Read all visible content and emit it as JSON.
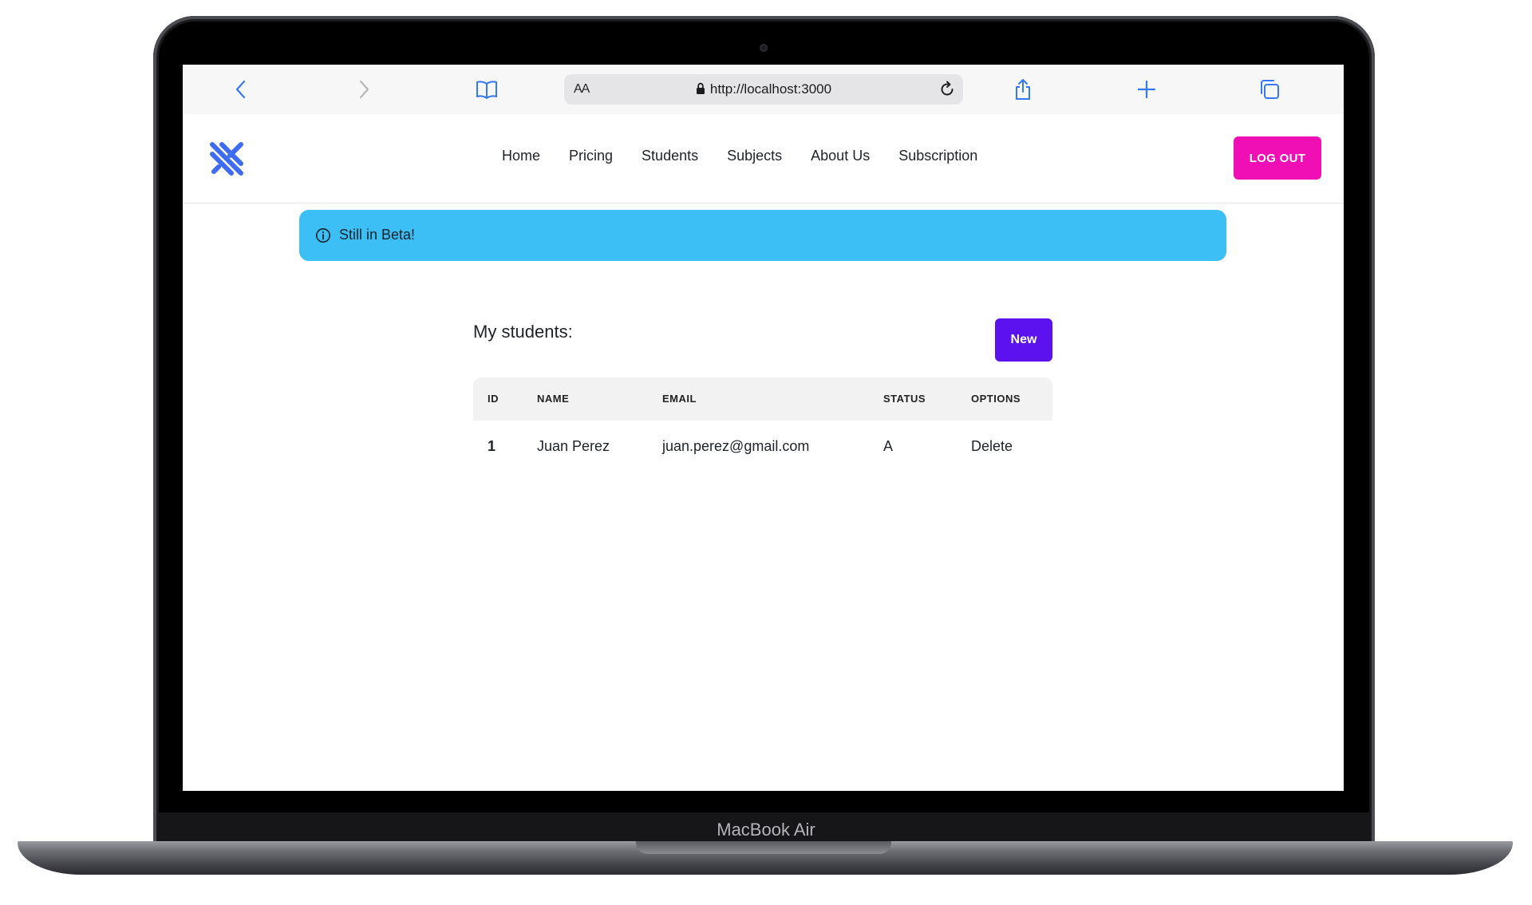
{
  "device": {
    "label": "MacBook Air"
  },
  "browser": {
    "text_size_label": "AA",
    "url": "http://localhost:3000",
    "toolbar": [
      "back-icon",
      "forward-icon",
      "bookmarks-icon",
      "share-icon",
      "new-tab-icon",
      "tabs-icon"
    ]
  },
  "site": {
    "nav": [
      {
        "label": "Home"
      },
      {
        "label": "Pricing"
      },
      {
        "label": "Students"
      },
      {
        "label": "Subjects"
      },
      {
        "label": "About Us"
      },
      {
        "label": "Subscription"
      }
    ],
    "logout_label": "LOG OUT"
  },
  "alert": {
    "text": "Still in Beta!",
    "color": "#3bbff5"
  },
  "students": {
    "title": "My students:",
    "new_label": "New",
    "columns": [
      "ID",
      "NAME",
      "EMAIL",
      "STATUS",
      "OPTIONS"
    ],
    "rows": [
      {
        "id": "1",
        "name": "Juan Perez",
        "email": "juan.perez@gmail.com",
        "status": "A",
        "option": "Delete"
      }
    ]
  },
  "colors": {
    "accent": "#3478f6",
    "logout": "#ef0fb4",
    "new_button": "#5b12ee",
    "logo": "#3d6cf2"
  }
}
